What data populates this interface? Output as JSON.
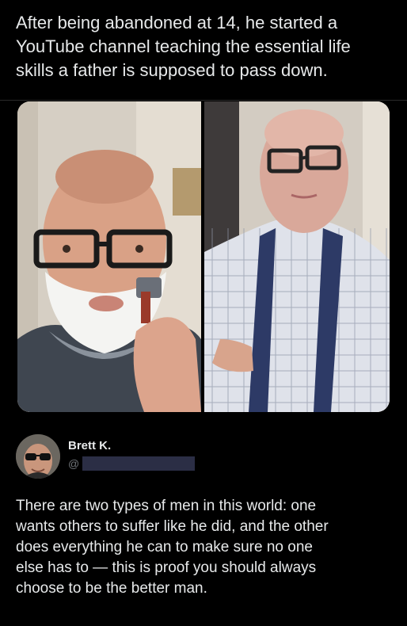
{
  "headline": "After being abandoned at 14, he started a\nYouTube channel teaching the essential life\nskills a father is supposed to pass down.",
  "photos": {
    "left_icon": "man-shaving-photo",
    "right_icon": "man-tying-tie-photo"
  },
  "author": {
    "name": "Brett K.",
    "handle": "@",
    "avatar_icon": "avatar-sunglasses"
  },
  "body": "There are two types of men in this world: one\nwants others to suffer like he did, and the other\ndoes everything he can to make sure no one\nelse has to — this is proof you should always\nchoose to be the better man.",
  "colors": {
    "background": "#000000",
    "text": "#e7e9ea",
    "muted": "#71767b",
    "redaction": "#2b2e45"
  }
}
